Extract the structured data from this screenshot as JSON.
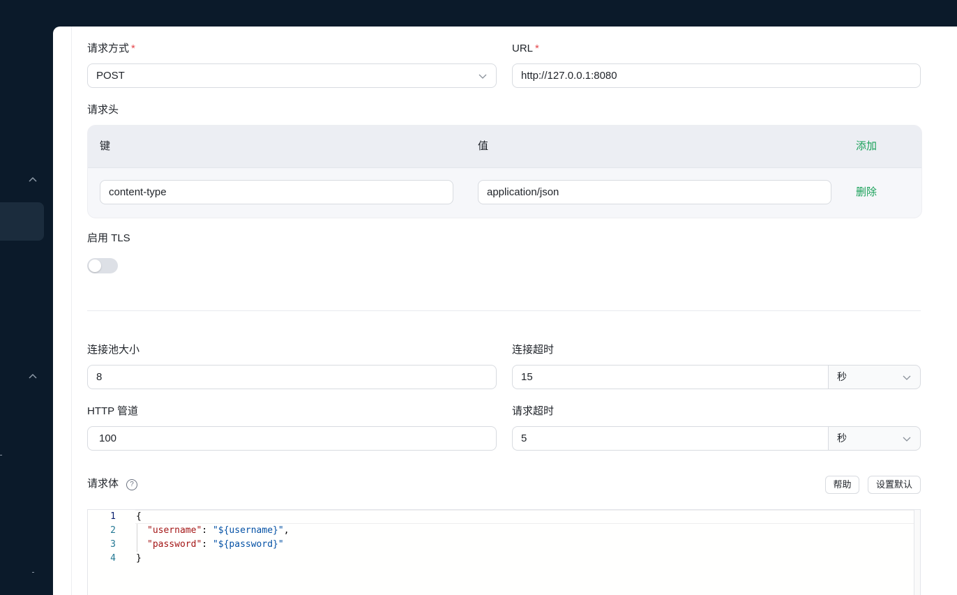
{
  "form": {
    "method": {
      "label": "请求方式",
      "required_mark": "*",
      "value": "POST"
    },
    "url": {
      "label": "URL",
      "required_mark": "*",
      "value": "http://127.0.0.1:8080"
    },
    "headers": {
      "label": "请求头",
      "columns": {
        "key": "键",
        "value": "值"
      },
      "add_label": "添加",
      "rows": [
        {
          "key": "content-type",
          "value": "application/json",
          "delete_label": "删除"
        }
      ]
    },
    "tls": {
      "label": "启用 TLS",
      "enabled": false
    },
    "pool_size": {
      "label": "连接池大小",
      "value": "8"
    },
    "connect_timeout": {
      "label": "连接超时",
      "value": "15",
      "unit": "秒"
    },
    "http_pipeline": {
      "label": "HTTP 管道",
      "value": "100"
    },
    "request_timeout": {
      "label": "请求超时",
      "value": "5",
      "unit": "秒"
    },
    "body": {
      "label": "请求体",
      "help_icon_text": "?",
      "help_button": "帮助",
      "default_button": "设置默认",
      "line_numbers": [
        "1",
        "2",
        "3",
        "4"
      ],
      "lines": {
        "l1": "{",
        "l2_key": "\"username\"",
        "l2_colon": ": ",
        "l2_value": "\"${username}\"",
        "l2_comma": ",",
        "l3_key": "\"password\"",
        "l3_colon": ": ",
        "l3_value": "\"${password}\"",
        "l4": "}"
      }
    }
  },
  "colors": {
    "sidebar": "#0b1a2a",
    "accent_green": "#18a058",
    "required_red": "#e5484d"
  },
  "icons": [
    "chevron-up-icon",
    "chevron-down-icon",
    "question-circle-icon"
  ]
}
